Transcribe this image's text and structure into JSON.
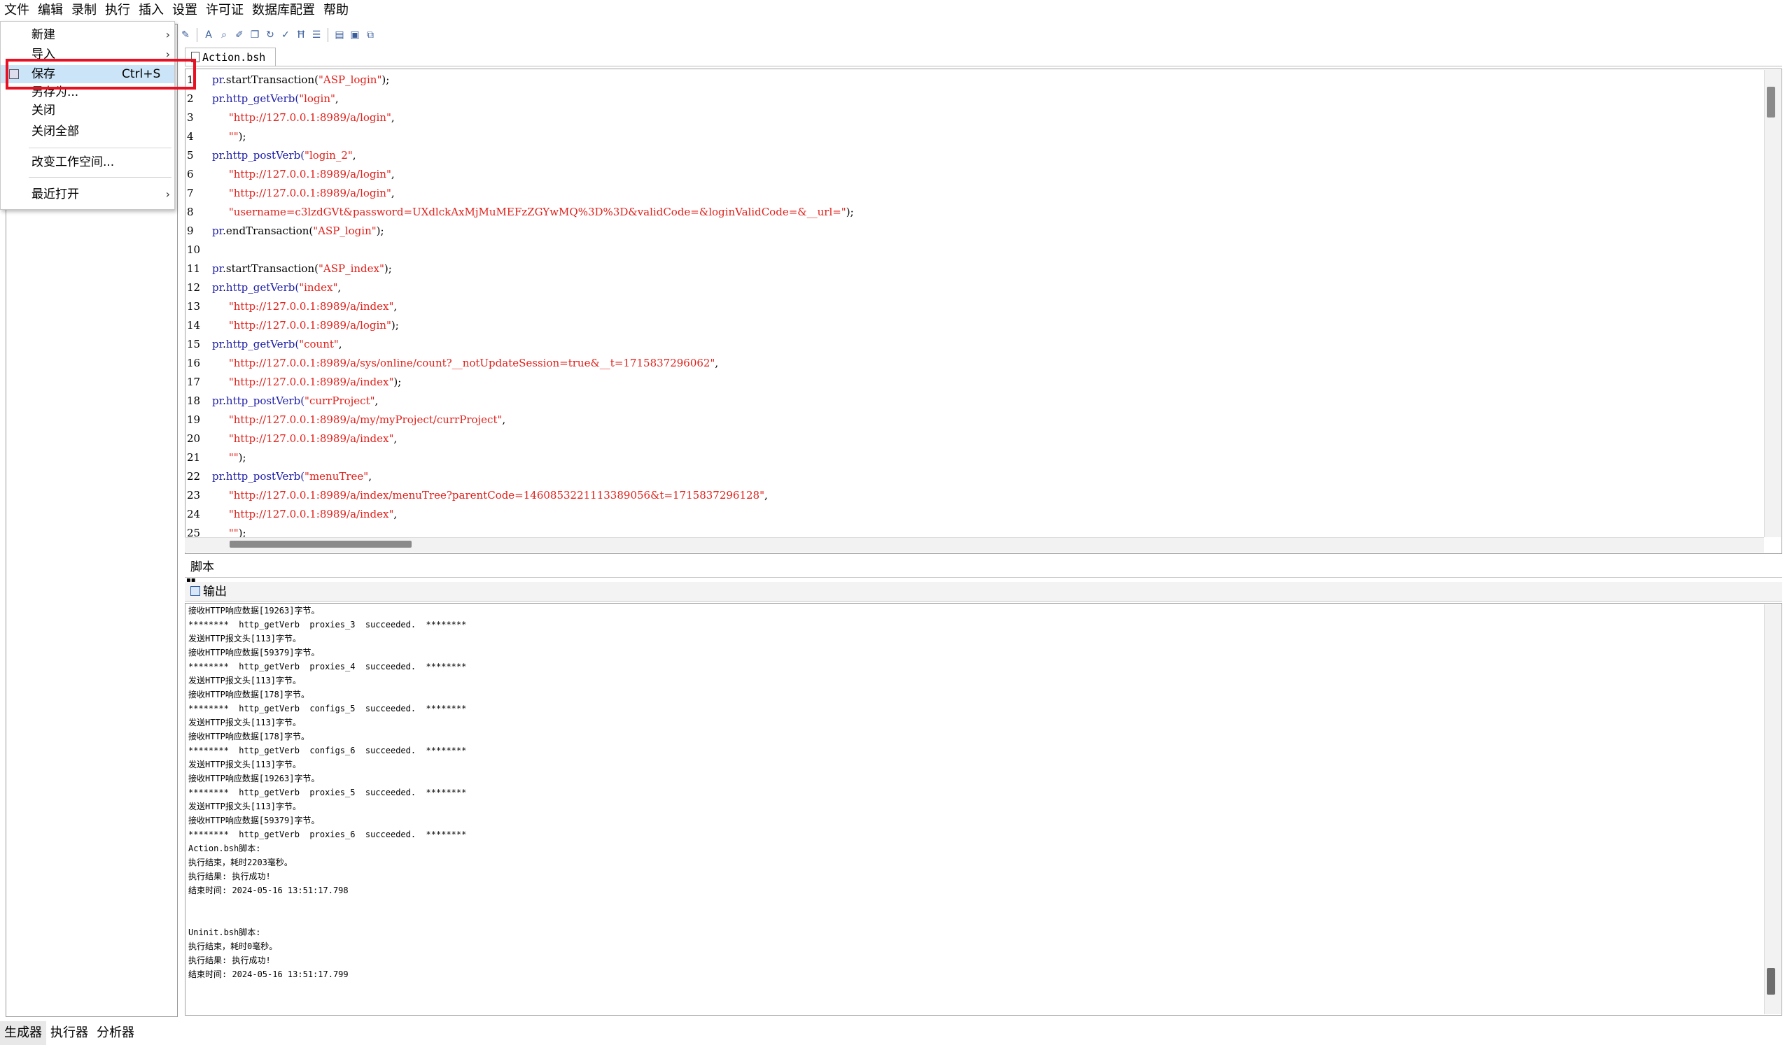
{
  "menubar": {
    "items": [
      "文件",
      "编辑",
      "录制",
      "执行",
      "插入",
      "设置",
      "许可证",
      "数据库配置",
      "帮助"
    ]
  },
  "file_menu": {
    "new": "新建",
    "import": "导入",
    "save": "保存",
    "save_shortcut": "Ctrl+S",
    "save_as": "另存为...",
    "close": "关闭",
    "close_all": "关闭全部",
    "change_workspace": "改变工作空间...",
    "recent": "最近打开",
    "submenu_arrow": "›"
  },
  "editor": {
    "tab_label": "Action.bsh",
    "lines": [
      {
        "n": "1",
        "parts": [
          [
            "kw",
            "pr"
          ],
          [
            "",
            "."
          ],
          [
            "",
            "startTransaction("
          ],
          [
            "str",
            "\"ASP_login\""
          ],
          [
            "",
            ");"
          ]
        ]
      },
      {
        "n": "2",
        "parts": [
          [
            "kw",
            "pr"
          ],
          [
            "",
            "."
          ],
          [
            "kw",
            "http_getVerb("
          ],
          [
            "str",
            "\"login\""
          ],
          [
            "",
            ","
          ]
        ]
      },
      {
        "n": "3",
        "parts": [
          [
            "",
            "     "
          ],
          [
            "str",
            "\"http://127.0.0.1:8989/a/login\""
          ],
          [
            "",
            ","
          ]
        ]
      },
      {
        "n": "4",
        "parts": [
          [
            "",
            "     "
          ],
          [
            "str",
            "\"\""
          ],
          [
            "",
            ");"
          ]
        ]
      },
      {
        "n": "5",
        "parts": [
          [
            "kw",
            "pr"
          ],
          [
            "",
            "."
          ],
          [
            "kw",
            "http_postVerb("
          ],
          [
            "str",
            "\"login_2\""
          ],
          [
            "",
            ","
          ]
        ]
      },
      {
        "n": "6",
        "parts": [
          [
            "",
            "     "
          ],
          [
            "str",
            "\"http://127.0.0.1:8989/a/login\""
          ],
          [
            "",
            ","
          ]
        ]
      },
      {
        "n": "7",
        "parts": [
          [
            "",
            "     "
          ],
          [
            "str",
            "\"http://127.0.0.1:8989/a/login\""
          ],
          [
            "",
            ","
          ]
        ]
      },
      {
        "n": "8",
        "parts": [
          [
            "",
            "     "
          ],
          [
            "str",
            "\"username=c3lzdGVt&password=UXdlckAxMjMuMEFzZGYwMQ%3D%3D&validCode=&loginValidCode=&__url=\""
          ],
          [
            "",
            ");"
          ]
        ]
      },
      {
        "n": "9",
        "parts": [
          [
            "kw",
            "pr"
          ],
          [
            "",
            "."
          ],
          [
            "",
            "endTransaction("
          ],
          [
            "str",
            "\"ASP_login\""
          ],
          [
            "",
            ");"
          ]
        ]
      },
      {
        "n": "10",
        "parts": []
      },
      {
        "n": "11",
        "parts": [
          [
            "kw",
            "pr"
          ],
          [
            "",
            "."
          ],
          [
            "",
            "startTransaction("
          ],
          [
            "str",
            "\"ASP_index\""
          ],
          [
            "",
            ");"
          ]
        ]
      },
      {
        "n": "12",
        "parts": [
          [
            "kw",
            "pr"
          ],
          [
            "",
            "."
          ],
          [
            "kw",
            "http_getVerb("
          ],
          [
            "str",
            "\"index\""
          ],
          [
            "",
            ","
          ]
        ]
      },
      {
        "n": "13",
        "parts": [
          [
            "",
            "     "
          ],
          [
            "str",
            "\"http://127.0.0.1:8989/a/index\""
          ],
          [
            "",
            ","
          ]
        ]
      },
      {
        "n": "14",
        "parts": [
          [
            "",
            "     "
          ],
          [
            "str",
            "\"http://127.0.0.1:8989/a/login\""
          ],
          [
            "",
            ");"
          ]
        ]
      },
      {
        "n": "15",
        "parts": [
          [
            "kw",
            "pr"
          ],
          [
            "",
            "."
          ],
          [
            "kw",
            "http_getVerb("
          ],
          [
            "str",
            "\"count\""
          ],
          [
            "",
            ","
          ]
        ]
      },
      {
        "n": "16",
        "parts": [
          [
            "",
            "     "
          ],
          [
            "str",
            "\"http://127.0.0.1:8989/a/sys/online/count?__notUpdateSession=true&__t=1715837296062\""
          ],
          [
            "",
            ","
          ]
        ]
      },
      {
        "n": "17",
        "parts": [
          [
            "",
            "     "
          ],
          [
            "str",
            "\"http://127.0.0.1:8989/a/index\""
          ],
          [
            "",
            ");"
          ]
        ]
      },
      {
        "n": "18",
        "parts": [
          [
            "kw",
            "pr"
          ],
          [
            "",
            "."
          ],
          [
            "kw",
            "http_postVerb("
          ],
          [
            "str",
            "\"currProject\""
          ],
          [
            "",
            ","
          ]
        ]
      },
      {
        "n": "19",
        "parts": [
          [
            "",
            "     "
          ],
          [
            "str",
            "\"http://127.0.0.1:8989/a/my/myProject/currProject\""
          ],
          [
            "",
            ","
          ]
        ]
      },
      {
        "n": "20",
        "parts": [
          [
            "",
            "     "
          ],
          [
            "str",
            "\"http://127.0.0.1:8989/a/index\""
          ],
          [
            "",
            ","
          ]
        ]
      },
      {
        "n": "21",
        "parts": [
          [
            "",
            "     "
          ],
          [
            "str",
            "\"\""
          ],
          [
            "",
            ");"
          ]
        ]
      },
      {
        "n": "22",
        "parts": [
          [
            "kw",
            "pr"
          ],
          [
            "",
            "."
          ],
          [
            "kw",
            "http_postVerb("
          ],
          [
            "str",
            "\"menuTree\""
          ],
          [
            "",
            ","
          ]
        ]
      },
      {
        "n": "23",
        "parts": [
          [
            "",
            "     "
          ],
          [
            "str",
            "\"http://127.0.0.1:8989/a/index/menuTree?parentCode=1460853221113389056&t=1715837296128\""
          ],
          [
            "",
            ","
          ]
        ]
      },
      {
        "n": "24",
        "parts": [
          [
            "",
            "     "
          ],
          [
            "str",
            "\"http://127.0.0.1:8989/a/index\""
          ],
          [
            "",
            ","
          ]
        ]
      },
      {
        "n": "25",
        "parts": [
          [
            "",
            "     "
          ],
          [
            "str",
            "\"\""
          ],
          [
            "",
            ");"
          ]
        ]
      }
    ]
  },
  "script_tab": "脚本",
  "output": {
    "tab_label": "输出",
    "lines": [
      "接收HTTP响应数据[19263]字节。",
      "********  http_getVerb  proxies_3  succeeded.  ********",
      "发送HTTP报文头[113]字节。",
      "接收HTTP响应数据[59379]字节。",
      "********  http_getVerb  proxies_4  succeeded.  ********",
      "发送HTTP报文头[113]字节。",
      "接收HTTP响应数据[178]字节。",
      "********  http_getVerb  configs_5  succeeded.  ********",
      "发送HTTP报文头[113]字节。",
      "接收HTTP响应数据[178]字节。",
      "********  http_getVerb  configs_6  succeeded.  ********",
      "发送HTTP报文头[113]字节。",
      "接收HTTP响应数据[19263]字节。",
      "********  http_getVerb  proxies_5  succeeded.  ********",
      "发送HTTP报文头[113]字节。",
      "接收HTTP响应数据[59379]字节。",
      "********  http_getVerb  proxies_6  succeeded.  ********",
      "Action.bsh脚本:",
      "执行结束，耗时2203毫秒。",
      "执行结果: 执行成功!",
      "结束时间: 2024-05-16 13:51:17.798",
      "",
      "",
      "Uninit.bsh脚本:",
      "执行结束，耗时0毫秒。",
      "执行结果: 执行成功!",
      "结束时间: 2024-05-16 13:51:17.799"
    ]
  },
  "bottom_tabs": [
    "生成器",
    "执行器",
    "分析器"
  ],
  "colors": {
    "highlight": "#e81123",
    "keyword": "#1a1aa6",
    "string": "#e0201a",
    "selection": "#cce4f7"
  }
}
